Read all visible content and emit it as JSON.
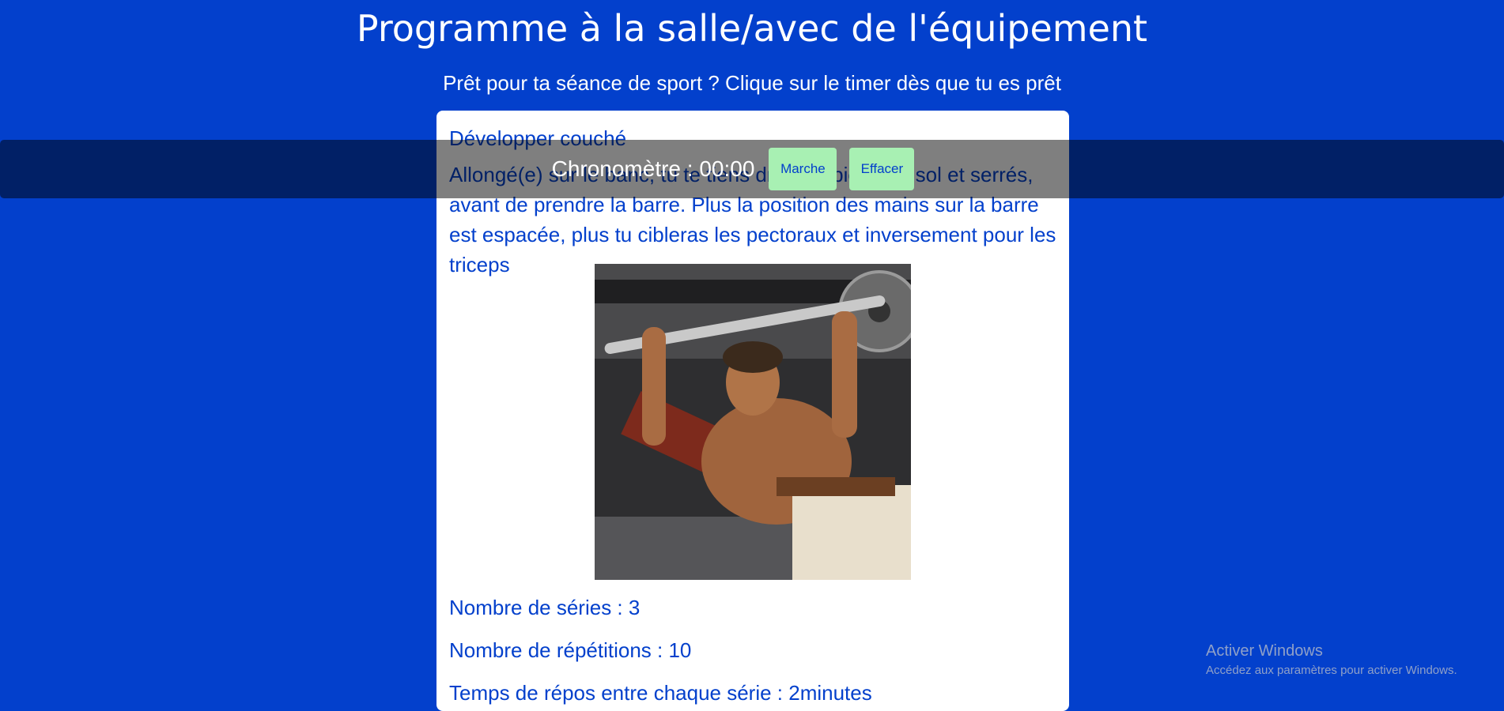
{
  "header": {
    "title": "Programme à la salle/avec de l'équipement",
    "subtitle": "Prêt pour ta séance de sport ? Clique sur le timer dès que tu es prêt"
  },
  "exercise": {
    "name": "Développer couché",
    "description": "Allongé(e) sur le banc, tu te tiens droit(e), pieds au sol et serrés, avant de prendre la barre. Plus la position des mains sur la barre est espacée, plus tu cibleras les pectoraux et inversement pour les triceps",
    "sets": "Nombre de séries : 3",
    "reps": "Nombre de répétitions : 10",
    "rest": "Temps de répos entre chaque série : 2minutes"
  },
  "timer": {
    "label": "Chronomètre : 00:00",
    "start_label": "Marche",
    "clear_label": "Effacer"
  },
  "watermark": {
    "title": "Activer Windows",
    "subtitle": "Accédez aux paramètres pour activer Windows."
  },
  "colors": {
    "background": "#0340cc",
    "button": "#a8f0b3",
    "card": "#ffffff"
  }
}
